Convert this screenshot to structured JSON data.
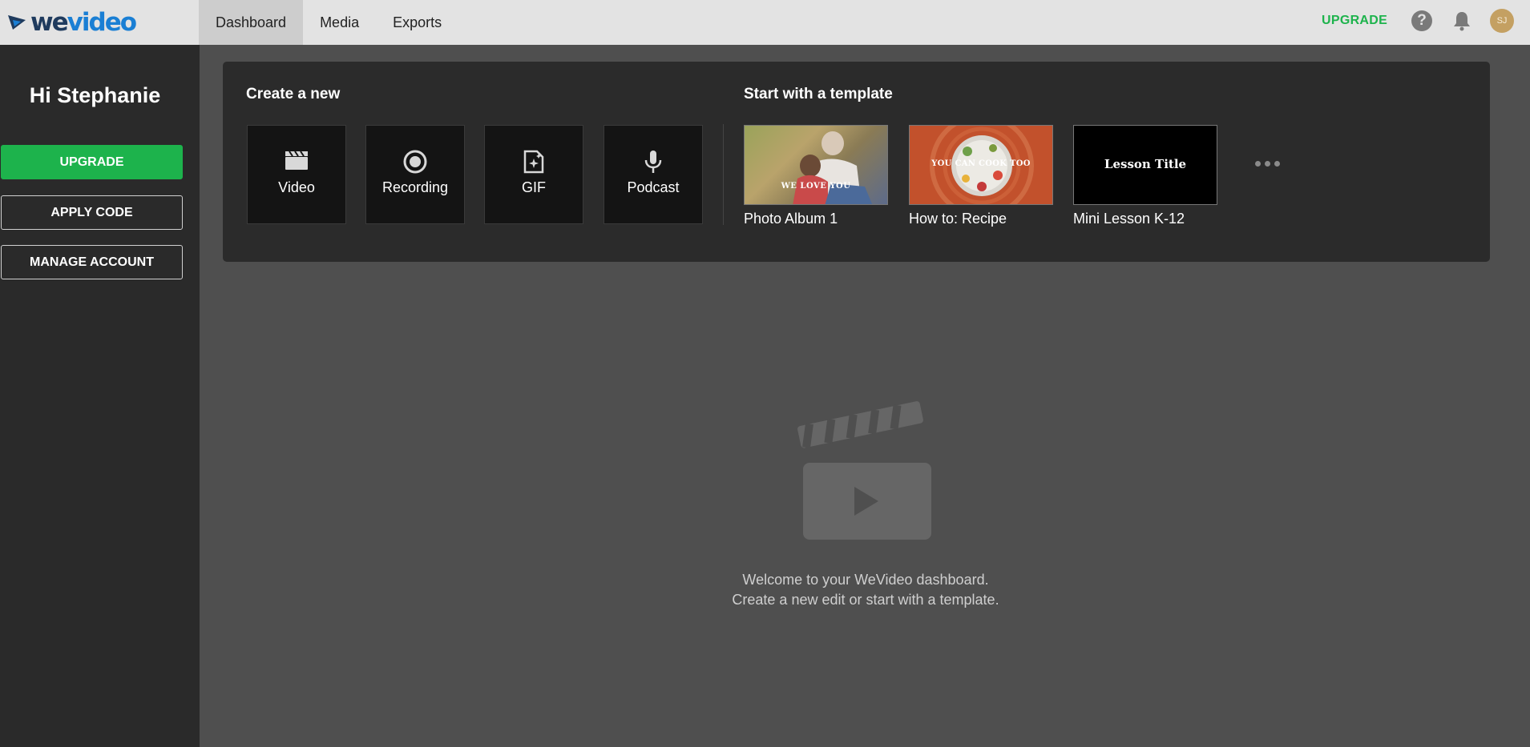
{
  "header": {
    "logo": {
      "we": "we",
      "video": "video"
    },
    "tabs": [
      {
        "label": "Dashboard",
        "active": true
      },
      {
        "label": "Media",
        "active": false
      },
      {
        "label": "Exports",
        "active": false
      }
    ],
    "upgrade_label": "UPGRADE",
    "help_glyph": "?",
    "avatar_initials": "SJ"
  },
  "sidebar": {
    "greeting": "Hi Stephanie",
    "buttons": {
      "upgrade": "UPGRADE",
      "apply_code": "APPLY CODE",
      "manage_account": "MANAGE ACCOUNT"
    }
  },
  "create": {
    "title": "Create a new",
    "items": [
      {
        "label": "Video",
        "icon": "clapperboard-icon"
      },
      {
        "label": "Recording",
        "icon": "record-icon"
      },
      {
        "label": "GIF",
        "icon": "gif-sparkle-icon"
      },
      {
        "label": "Podcast",
        "icon": "microphone-icon"
      }
    ]
  },
  "templates": {
    "title": "Start with a template",
    "items": [
      {
        "label": "Photo Album 1",
        "thumb_text": "WE LOVE YOU"
      },
      {
        "label": "How to: Recipe",
        "thumb_text": "YOU CAN COOK TOO"
      },
      {
        "label": "Mini Lesson K-12",
        "thumb_text": "Lesson Title"
      }
    ]
  },
  "empty_state": {
    "line1": "Welcome to your WeVideo dashboard.",
    "line2": "Create a new edit or start with a template."
  },
  "colors": {
    "accent_green": "#1db34c",
    "topbar_bg": "#e3e3e3",
    "sidebar_bg": "#2a2a2a",
    "main_bg": "#4f4f4f",
    "panel_bg": "#2b2b2b"
  }
}
